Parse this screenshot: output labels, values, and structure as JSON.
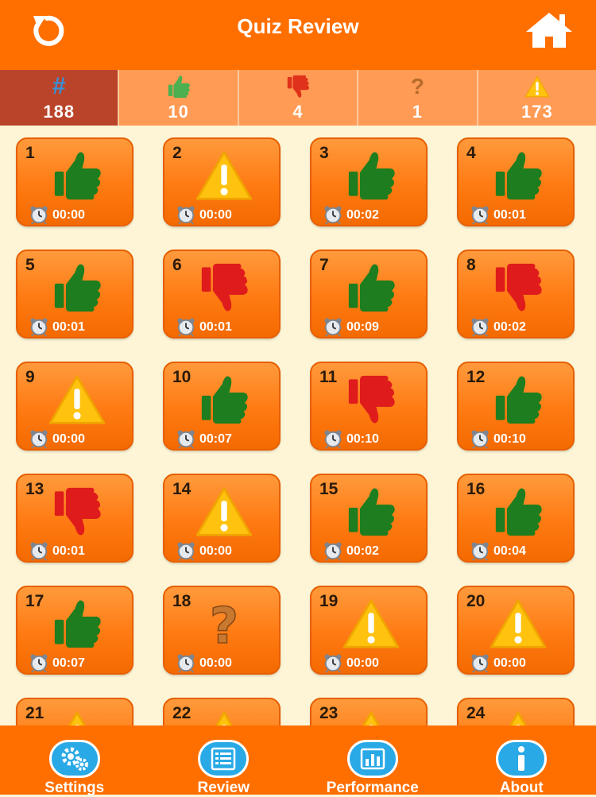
{
  "header": {
    "title": "Quiz Review",
    "refresh_icon": "refresh-icon",
    "home_icon": "home-icon"
  },
  "stats": [
    {
      "icon": "hash",
      "symbol": "#",
      "value": "188"
    },
    {
      "icon": "thumbs-up-icon",
      "value": "10"
    },
    {
      "icon": "thumbs-down-icon",
      "value": "4"
    },
    {
      "icon": "question-icon",
      "symbol": "?",
      "value": "1"
    },
    {
      "icon": "warning-icon",
      "value": "173"
    }
  ],
  "colors": {
    "orange": "#ff6f00",
    "green": "#1e7d1e",
    "red": "#e01b1b",
    "warning": "#ffc20e",
    "background": "#fdf5d6",
    "active_stat": "#b9442a"
  },
  "questions": [
    {
      "num": "1",
      "status": "correct",
      "time": "00:00"
    },
    {
      "num": "2",
      "status": "skipped",
      "time": "00:00"
    },
    {
      "num": "3",
      "status": "correct",
      "time": "00:02"
    },
    {
      "num": "4",
      "status": "correct",
      "time": "00:01"
    },
    {
      "num": "5",
      "status": "correct",
      "time": "00:01"
    },
    {
      "num": "6",
      "status": "wrong",
      "time": "00:01"
    },
    {
      "num": "7",
      "status": "correct",
      "time": "00:09"
    },
    {
      "num": "8",
      "status": "wrong",
      "time": "00:02"
    },
    {
      "num": "9",
      "status": "skipped",
      "time": "00:00"
    },
    {
      "num": "10",
      "status": "correct",
      "time": "00:07"
    },
    {
      "num": "11",
      "status": "wrong",
      "time": "00:10"
    },
    {
      "num": "12",
      "status": "correct",
      "time": "00:10"
    },
    {
      "num": "13",
      "status": "wrong",
      "time": "00:01"
    },
    {
      "num": "14",
      "status": "skipped",
      "time": "00:00"
    },
    {
      "num": "15",
      "status": "correct",
      "time": "00:02"
    },
    {
      "num": "16",
      "status": "correct",
      "time": "00:04"
    },
    {
      "num": "17",
      "status": "correct",
      "time": "00:07"
    },
    {
      "num": "18",
      "status": "unsure",
      "time": "00:00"
    },
    {
      "num": "19",
      "status": "skipped",
      "time": "00:00"
    },
    {
      "num": "20",
      "status": "skipped",
      "time": "00:00"
    },
    {
      "num": "21",
      "status": "skipped",
      "time": ""
    },
    {
      "num": "22",
      "status": "skipped",
      "time": ""
    },
    {
      "num": "23",
      "status": "skipped",
      "time": ""
    },
    {
      "num": "24",
      "status": "skipped",
      "time": ""
    }
  ],
  "tabs": [
    {
      "label": "Settings",
      "icon": "gears-icon"
    },
    {
      "label": "Review",
      "icon": "review-list-icon"
    },
    {
      "label": "Performance",
      "icon": "bar-chart-icon"
    },
    {
      "label": "About",
      "icon": "info-icon"
    }
  ]
}
